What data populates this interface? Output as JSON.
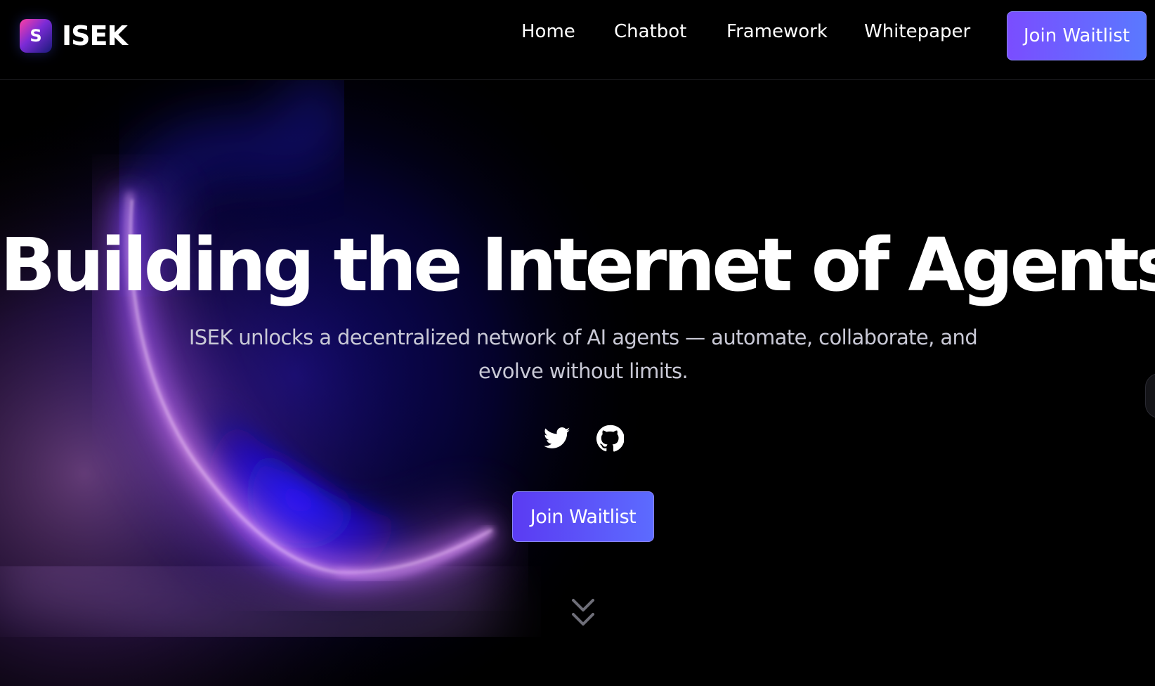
{
  "brand": {
    "logo_letter": "S",
    "name": "ISEK"
  },
  "nav": {
    "links": [
      {
        "label": "Home"
      },
      {
        "label": "Chatbot"
      },
      {
        "label": "Framework"
      },
      {
        "label": "Whitepaper"
      }
    ],
    "cta_label": "Join Waitlist"
  },
  "hero": {
    "title": "Building the Internet of Agents",
    "subtitle_line1": "ISEK unlocks a decentralized network of AI agents — automate, collaborate, and",
    "subtitle_line2": "evolve without limits.",
    "social_icons": [
      "twitter-icon",
      "github-icon"
    ],
    "cta_label": "Join Waitlist",
    "scroll_icon": "double-chevron-down-icon"
  },
  "colors": {
    "background": "#000000",
    "accent_start": "#7a4dff",
    "accent_end": "#5a79ff",
    "glow_pink": "#e68bff",
    "glow_blue": "#1a10ff",
    "subtitle_text": "#c9c9d6"
  }
}
